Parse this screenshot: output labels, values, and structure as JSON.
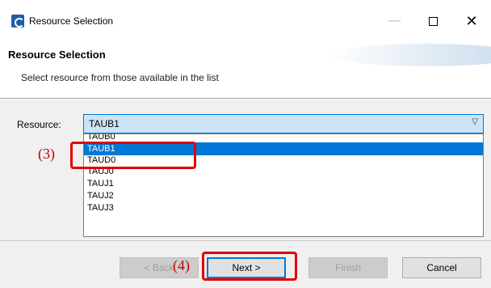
{
  "window": {
    "title": "Resource Selection"
  },
  "header": {
    "title": "Resource Selection",
    "description": "Select resource from those available in the list"
  },
  "form": {
    "resource_label": "Resource:",
    "selected_value": "TAUB1",
    "items": [
      "TAUB0",
      "TAUB1",
      "TAUD0",
      "TAUJ0",
      "TAUJ1",
      "TAUJ2",
      "TAUJ3"
    ],
    "selected_index": 1
  },
  "buttons": {
    "back": "< Back",
    "next": "Next >",
    "finish": "Finish",
    "cancel": "Cancel"
  },
  "annotations": {
    "step3": "(3)",
    "step4": "(4)"
  },
  "colors": {
    "highlight": "#e00000",
    "selection": "#0078d7",
    "combo_bg": "#cce4f7"
  }
}
